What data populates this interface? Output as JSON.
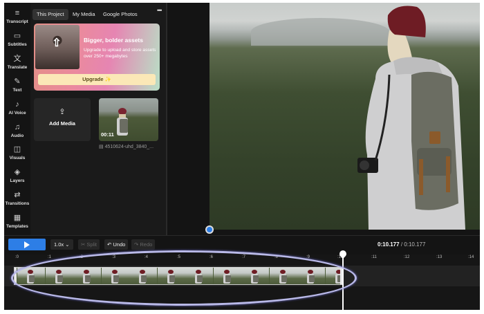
{
  "rail": {
    "items": [
      {
        "label": "Transcript",
        "icon": "transcript-icon",
        "glyph": "≡"
      },
      {
        "label": "Subtitles",
        "icon": "subtitles-icon",
        "glyph": "▭"
      },
      {
        "label": "Translate",
        "icon": "translate-icon",
        "glyph": "文"
      },
      {
        "label": "Text",
        "icon": "text-icon",
        "glyph": "✎"
      },
      {
        "label": "AI Voice",
        "icon": "ai-voice-icon",
        "glyph": "♪"
      },
      {
        "label": "Audio",
        "icon": "audio-icon",
        "glyph": "♫"
      },
      {
        "label": "Visuals",
        "icon": "visuals-icon",
        "glyph": "◫"
      },
      {
        "label": "Layers",
        "icon": "layers-icon",
        "glyph": "◈"
      },
      {
        "label": "Transitions",
        "icon": "transitions-icon",
        "glyph": "⇄"
      },
      {
        "label": "Templates",
        "icon": "templates-icon",
        "glyph": "▦"
      }
    ]
  },
  "panel": {
    "tabs": [
      "This Project",
      "My Media",
      "Google Photos"
    ],
    "active_tab": "This Project",
    "more": "•••",
    "promo": {
      "title": "Bigger, bolder assets",
      "description": "Upgrade to upload and store assets over 250+ megabytes",
      "button": "Upgrade ✨"
    },
    "add_media": {
      "label": "Add Media",
      "icon": "upload-icon"
    },
    "media": {
      "duration": "00:11",
      "filename": "4510624-uhd_3840_..."
    }
  },
  "controls": {
    "speed": "1.0x",
    "split": "Split",
    "undo": "Undo",
    "redo": "Redo",
    "current_time": "0:10.177",
    "total_time": "0:10.177",
    "time_separator": " / "
  },
  "timeline": {
    "ticks": [
      ":0",
      ":1",
      ":2",
      ":3",
      ":4",
      ":5",
      ":6",
      ":7",
      ":8",
      ":9",
      ":10",
      ":11",
      ":12",
      ":13",
      ":14"
    ]
  },
  "colors": {
    "accent": "#2d7ee6",
    "background": "#141414",
    "highlight_oval": "#b9b9e8"
  }
}
